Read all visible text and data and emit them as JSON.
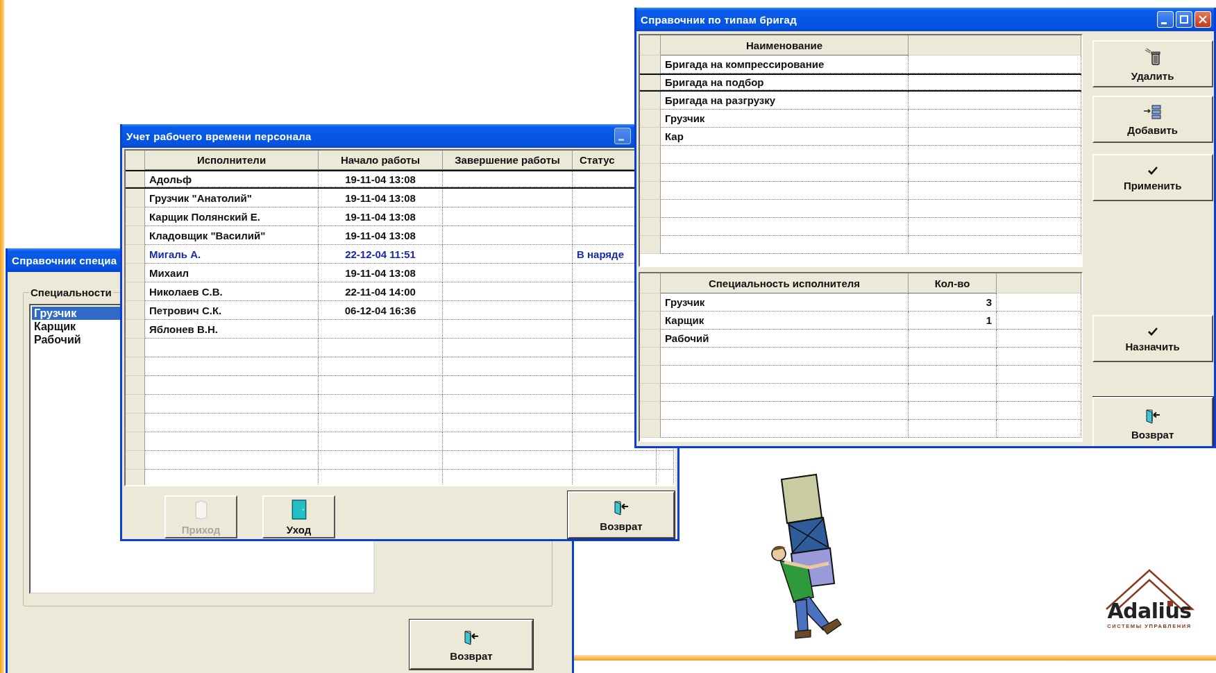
{
  "windows": [
    {
      "kind": "specialties",
      "title": "Справочник специа",
      "group_label": "Специальности",
      "items": [
        {
          "label": "Грузчик",
          "selected": true
        },
        {
          "label": "Карщик",
          "selected": false
        },
        {
          "label": "Рабочий",
          "selected": false
        }
      ],
      "buttons": [
        {
          "label": "Возврат",
          "kind": "exit"
        }
      ]
    },
    {
      "kind": "timesheet",
      "title": "Учет рабочего времени персонала",
      "columns": [
        "Исполнители",
        "Начало работы",
        "Завершение работы",
        "Статус"
      ],
      "rows": [
        {
          "name": "Адольф",
          "start": "19-11-04 13:08",
          "selected": true,
          "highlighted": false
        },
        {
          "name": "Грузчик \"Анатолий\"",
          "start": "19-11-04 13:08",
          "selected": false,
          "highlighted": false
        },
        {
          "name": "Карщик Полянский Е.",
          "start": "19-11-04 13:08",
          "selected": false,
          "highlighted": false
        },
        {
          "name": "Кладовщик \"Василий\"",
          "start": "19-11-04 13:08",
          "selected": false,
          "highlighted": false
        },
        {
          "name": "Мигаль А.",
          "start": "22-12-04 11:51",
          "status": "В наряде",
          "selected": false,
          "highlighted": true
        },
        {
          "name": "Михаил",
          "start": "19-11-04 13:08",
          "selected": false,
          "highlighted": false
        },
        {
          "name": "Николаев С.В.",
          "start": "22-11-04 14:00",
          "selected": false,
          "highlighted": false
        },
        {
          "name": "Петрович С.К.",
          "start": "06-12-04 16:36",
          "selected": false,
          "highlighted": false
        },
        {
          "name": "Яблонев В.Н.",
          "selected": false,
          "highlighted": false
        }
      ],
      "buttons": [
        {
          "label": "Приход",
          "kind": "enter",
          "disabled": true
        },
        {
          "label": "Уход",
          "kind": "leave",
          "disabled": false
        },
        {
          "label": "Возврат",
          "kind": "exit",
          "disabled": false
        }
      ]
    },
    {
      "kind": "brigades",
      "title": "Справочник по типам бригад",
      "brigade_table": {
        "columns": [
          "Наименование"
        ],
        "rows": [
          {
            "name": "Бригада на компрессирование",
            "selected": false
          },
          {
            "name": "Бригада на подбор",
            "selected": true
          },
          {
            "name": "Бригада на разгрузку",
            "selected": false
          },
          {
            "name": "Грузчик",
            "selected": false
          },
          {
            "name": "Кар",
            "selected": false
          }
        ]
      },
      "specialty_table": {
        "columns": [
          "Специальность исполнителя",
          "Кол-во"
        ],
        "rows": [
          {
            "name": "Грузчик",
            "count": "3"
          },
          {
            "name": "Карщик",
            "count": "1"
          },
          {
            "name": "Рабочий"
          }
        ]
      },
      "buttons": [
        {
          "label": "Удалить",
          "kind": "delete"
        },
        {
          "label": "Добавить",
          "kind": "add"
        },
        {
          "label": "Применить",
          "kind": "apply"
        },
        {
          "label": "Назначить",
          "kind": "assign"
        },
        {
          "label": "Возврат",
          "kind": "exit"
        }
      ]
    }
  ],
  "logo": {
    "wordmark": "Adalius",
    "tagline": "СИСТЕМЫ УПРАВЛЕНИЯ"
  }
}
